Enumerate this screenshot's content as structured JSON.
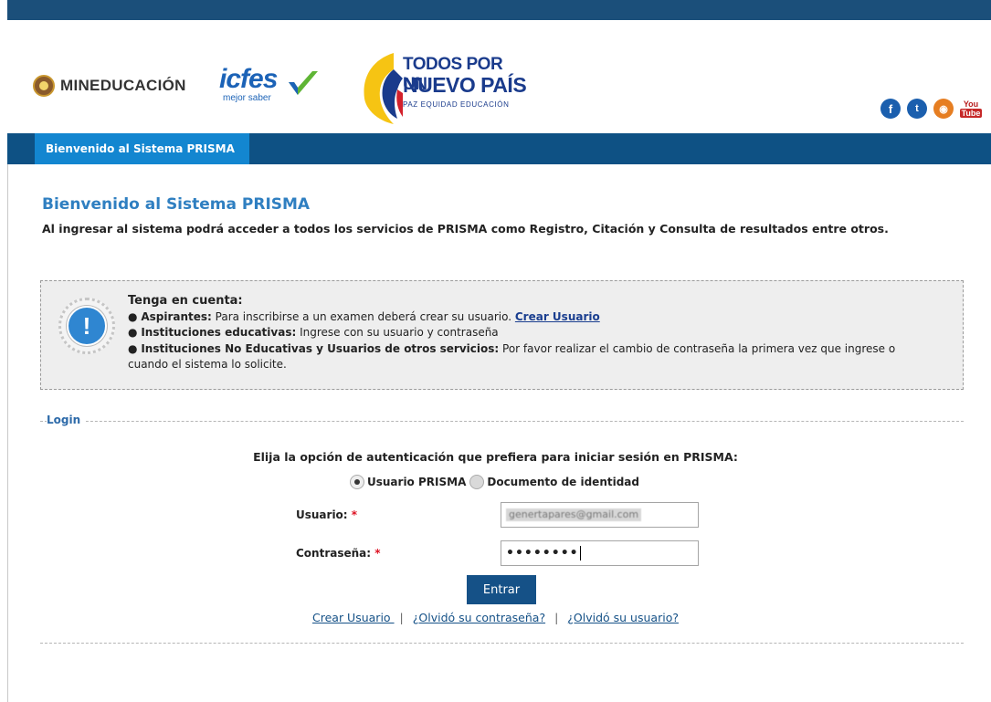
{
  "header": {
    "min_logo_text": "MINEDUCACIÓN",
    "icfes_word": "icfes",
    "icfes_tagline": "mejor saber",
    "tpun_line1": "TODOS POR UN",
    "tpun_line2": "NUEVO PAÍS",
    "tpun_sub": "PAZ  EQUIDAD  EDUCACIÓN",
    "social": {
      "facebook": "f",
      "twitter": "t",
      "rss": "◉",
      "youtube_top": "You",
      "youtube_bottom": "Tube"
    }
  },
  "nav": {
    "tab_label": "Bienvenido al Sistema PRISMA"
  },
  "main": {
    "title": "Bienvenido al Sistema PRISMA",
    "intro": "Al ingresar al sistema podrá acceder a todos los servicios de PRISMA como Registro, Citación y Consulta de resultados entre otros."
  },
  "notice": {
    "icon_glyph": "!",
    "title": "Tenga en cuenta:",
    "bullet": "●",
    "item1_label": "Aspirantes:",
    "item1_text": " Para inscribirse a un examen deberá crear su usuario. ",
    "item1_link": "Crear Usuario ",
    "item2_label": "Instituciones educativas:",
    "item2_text": " Ingrese con su usuario y contraseña",
    "item3_label": "Instituciones No Educativas y Usuarios de otros servicios:",
    "item3_text": " Por favor realizar el cambio de contraseña la primera vez que ingrese o cuando el sistema lo solicite."
  },
  "login": {
    "legend": "Login",
    "choose_text": "Elija la opción de autenticación que prefiera para iniciar sesión en PRISMA:",
    "option_prisma": "Usuario PRISMA",
    "option_documento": "Documento de identidad",
    "selected_option": "Usuario PRISMA",
    "usuario_label": "Usuario:",
    "usuario_value": "genertapares@gmail.com",
    "password_label": "Contraseña:",
    "password_value": "••••••••",
    "required_mark": "*",
    "submit_label": "Entrar",
    "link_create": "Crear Usuario ",
    "link_forgot_password": "¿Olvidó su contraseña?",
    "link_forgot_user": "¿Olvidó su usuario?",
    "separator": "|"
  },
  "colors": {
    "nav_bar": "#0e5184",
    "nav_tab": "#1386d0",
    "title_blue": "#2f7fc1",
    "button": "#155187",
    "required": "#dd1122"
  }
}
